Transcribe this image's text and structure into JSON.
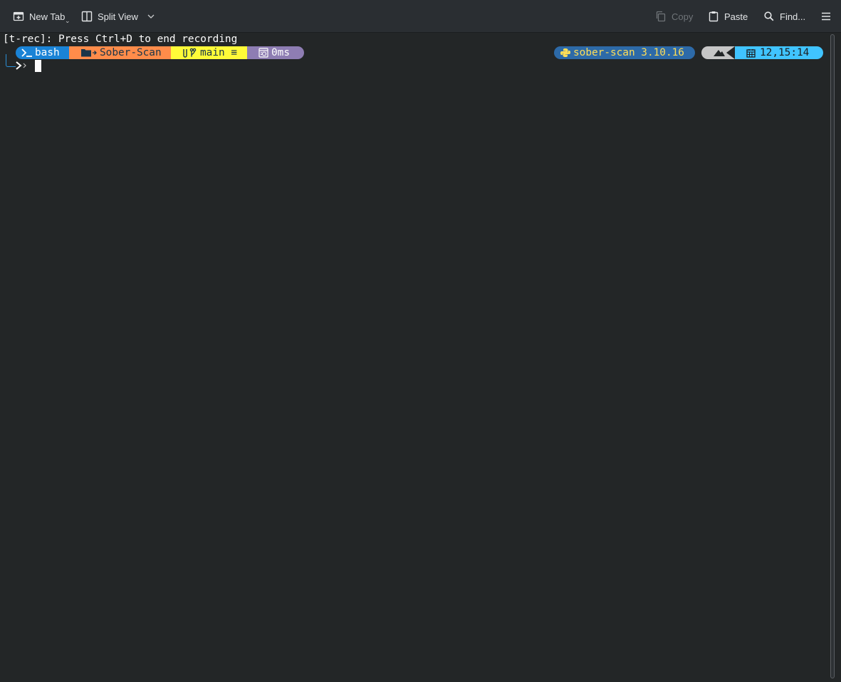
{
  "toolbar": {
    "new_tab": "New Tab",
    "split_view": "Split View",
    "copy": "Copy",
    "paste": "Paste",
    "find": "Find..."
  },
  "terminal": {
    "line1": "[t-rec]: Press Ctrl+D to end recording",
    "prompt_left": {
      "shell": "bash",
      "dir": "Sober-Scan",
      "branch": "main ≡",
      "duration": "0ms"
    },
    "prompt_right": {
      "python_env": "sober-scan 3.10.16",
      "clock": "12,15:14"
    }
  },
  "colors": {
    "background": "#232627",
    "toolbar": "#2a2e32",
    "shell_segment": "#1a83d6",
    "dir_segment": "#ff8c4a",
    "git_segment": "#fffb38",
    "time_segment": "#8e7db3",
    "python_segment": "#2d6aa8",
    "clock_segment": "#40c4ff"
  },
  "icons": [
    "new-tab-icon",
    "split-view-icon",
    "chevron-down-icon",
    "copy-icon",
    "paste-icon",
    "search-icon",
    "hamburger-menu-icon",
    "terminal-icon",
    "folder-icon",
    "git-branch-icon",
    "stopwatch-icon",
    "python-icon",
    "shell-icon",
    "calendar-icon"
  ]
}
